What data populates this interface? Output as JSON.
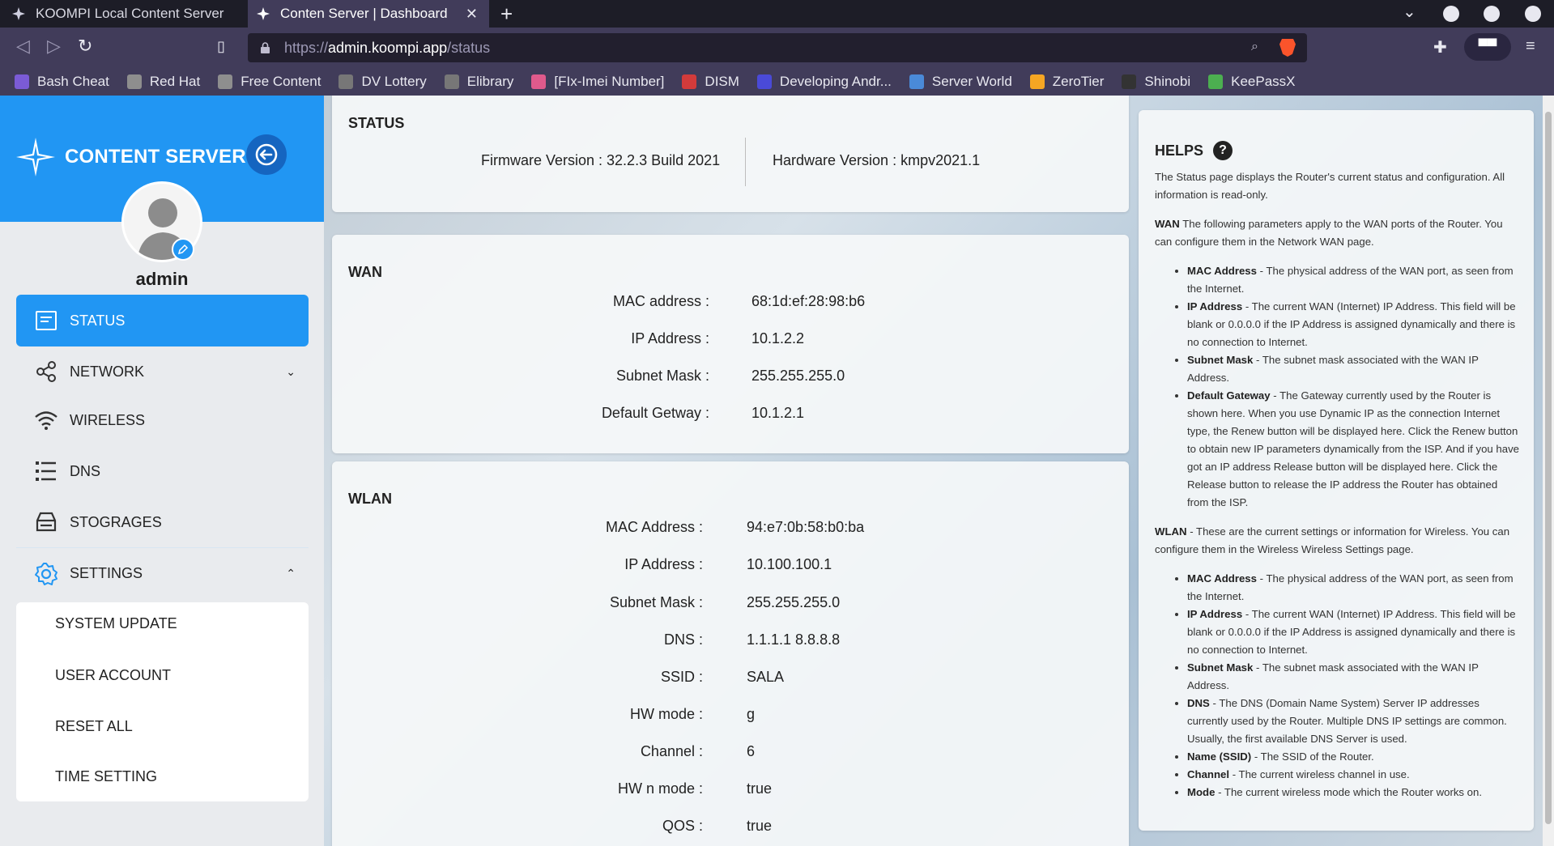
{
  "browser": {
    "tabs": [
      {
        "title": "KOOMPI Local Content Server",
        "active": false
      },
      {
        "title": "Conten Server | Dashboard",
        "active": true
      }
    ],
    "url_scheme": "https://",
    "url_host": "admin.koompi.app",
    "url_path": "/status",
    "bookmarks": [
      {
        "label": "Bash Cheat",
        "color": "#7b5bd6"
      },
      {
        "label": "Red Hat",
        "color": "#8e8e8e"
      },
      {
        "label": "Free Content",
        "color": "#8e8e8e"
      },
      {
        "label": "DV Lottery",
        "color": "#777777"
      },
      {
        "label": "Elibrary",
        "color": "#777777"
      },
      {
        "label": "[FIx-Imei Number]",
        "color": "#e05a8c"
      },
      {
        "label": "DISM",
        "color": "#d23b3b"
      },
      {
        "label": "Developing Andr...",
        "color": "#4a4ad8"
      },
      {
        "label": "Server World",
        "color": "#4a8ad8"
      },
      {
        "label": "ZeroTier",
        "color": "#f5a623"
      },
      {
        "label": "Shinobi",
        "color": "#333333"
      },
      {
        "label": "KeePassX",
        "color": "#4caf50"
      }
    ]
  },
  "sidebar": {
    "logo_text": "CONTENT SERVER",
    "username": "admin",
    "items": [
      {
        "label": "STATUS",
        "icon": "status-icon",
        "active": true
      },
      {
        "label": "NETWORK",
        "icon": "share-icon",
        "active": false
      },
      {
        "label": "WIRELESS",
        "icon": "wifi-icon",
        "active": false
      },
      {
        "label": "DNS",
        "icon": "dns-icon",
        "active": false
      },
      {
        "label": "STOGRAGES",
        "icon": "storage-icon",
        "active": false
      },
      {
        "label": "SETTINGS",
        "icon": "gear-icon",
        "active": false
      }
    ],
    "settings_submenu": [
      "SYSTEM UPDATE",
      "USER ACCOUNT",
      "RESET ALL",
      "TIME SETTING"
    ],
    "accent_color": "#2196f3"
  },
  "status": {
    "title": "STATUS",
    "firmware": "Firmware Version : 32.2.3 Build 2021",
    "hardware": "Hardware Version : kmpv2021.1"
  },
  "wan": {
    "title": "WAN",
    "rows": [
      {
        "label": "MAC address :",
        "value": "68:1d:ef:28:98:b6"
      },
      {
        "label": "IP Address :",
        "value": "10.1.2.2"
      },
      {
        "label": "Subnet Mask :",
        "value": "255.255.255.0"
      },
      {
        "label": "Default Getway :",
        "value": "10.1.2.1"
      }
    ]
  },
  "wlan": {
    "title": "WLAN",
    "rows": [
      {
        "label": "MAC Address :",
        "value": "94:e7:0b:58:b0:ba"
      },
      {
        "label": "IP Address :",
        "value": "10.100.100.1"
      },
      {
        "label": "Subnet Mask :",
        "value": "255.255.255.0"
      },
      {
        "label": "DNS :",
        "value": "1.1.1.1 8.8.8.8"
      },
      {
        "label": "SSID :",
        "value": "SALA"
      },
      {
        "label": "HW mode :",
        "value": "g"
      },
      {
        "label": "Channel :",
        "value": "6"
      },
      {
        "label": "HW n mode :",
        "value": "true"
      },
      {
        "label": "QOS :",
        "value": "true"
      }
    ]
  },
  "helps": {
    "title": "HELPS",
    "intro": "The Status page displays the Router's current status and configuration. All information is read-only.",
    "wan_heading": "WAN",
    "wan_text": " The following parameters apply to the WAN ports of the Router. You can configure them in the Network WAN page.",
    "wan_items": [
      {
        "term": "MAC Address",
        "desc": " - The physical address of the WAN port, as seen from the Internet."
      },
      {
        "term": "IP Address",
        "desc": " - The current WAN (Internet) IP Address. This field will be blank or 0.0.0.0 if the IP Address is assigned dynamically and there is no connection to Internet."
      },
      {
        "term": "Subnet Mask",
        "desc": " - The subnet mask associated with the WAN IP Address."
      },
      {
        "term": "Default Gateway",
        "desc": " - The Gateway currently used by the Router is shown here. When you use Dynamic IP as the connection Internet type, the Renew button will be displayed here. Click the Renew button to obtain new IP parameters dynamically from the ISP. And if you have got an IP address Release button will be displayed here. Click the Release button to release the IP address the Router has obtained from the ISP."
      }
    ],
    "wlan_heading": "WLAN",
    "wlan_text": " - These are the current settings or information for Wireless. You can configure them in the Wireless Wireless Settings page.",
    "wlan_items": [
      {
        "term": "MAC Address",
        "desc": " - The physical address of the WAN port, as seen from the Internet."
      },
      {
        "term": "IP Address",
        "desc": " - The current WAN (Internet) IP Address. This field will be blank or 0.0.0.0 if the IP Address is assigned dynamically and there is no connection to Internet."
      },
      {
        "term": "Subnet Mask",
        "desc": " - The subnet mask associated with the WAN IP Address."
      },
      {
        "term": "DNS",
        "desc": " - The DNS (Domain Name System) Server IP addresses currently used by the Router. Multiple DNS IP settings are common. Usually, the first available DNS Server is used."
      },
      {
        "term": "Name (SSID)",
        "desc": " - The SSID of the Router."
      },
      {
        "term": "Channel",
        "desc": " - The current wireless channel in use."
      },
      {
        "term": "Mode",
        "desc": " - The current wireless mode which the Router works on."
      }
    ]
  }
}
